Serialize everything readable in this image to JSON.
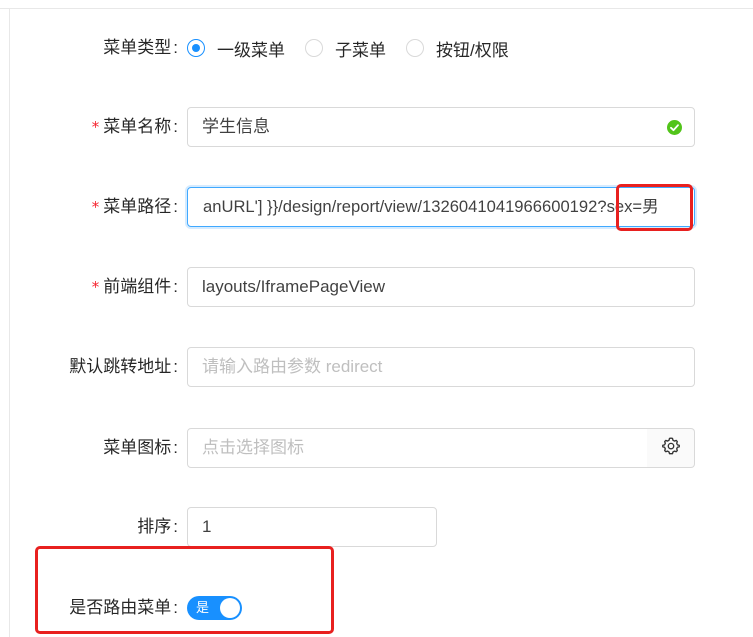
{
  "menu_type": {
    "label": "菜单类型",
    "colon": ":",
    "options": [
      {
        "label": "一级菜单",
        "checked": true
      },
      {
        "label": "子菜单",
        "checked": false
      },
      {
        "label": "按钮/权限",
        "checked": false
      }
    ]
  },
  "menu_name": {
    "required_mark": "*",
    "label": "菜单名称",
    "colon": ":",
    "value": "学生信息",
    "status_icon": "check-circle-icon"
  },
  "menu_path": {
    "required_mark": "*",
    "label": "菜单路径",
    "colon": ":",
    "value": "anURL'] }}/design/report/view/1326041041966600192?sex=男"
  },
  "frontend_component": {
    "required_mark": "*",
    "label": "前端组件",
    "colon": ":",
    "value": "layouts/IframePageView"
  },
  "default_redirect": {
    "label": "默认跳转地址",
    "colon": ":",
    "placeholder": "请输入路由参数 redirect"
  },
  "menu_icon": {
    "label": "菜单图标",
    "colon": ":",
    "placeholder": "点击选择图标",
    "addon_icon": "gear-icon"
  },
  "sort_order": {
    "label": "排序",
    "colon": ":",
    "value": "1"
  },
  "is_route": {
    "label": "是否路由菜单",
    "colon": ":",
    "switch_text": "是",
    "checked": true
  },
  "colors": {
    "primary": "#1890ff",
    "success": "#52c41a",
    "required": "#f5222d",
    "annotation_box": "#e8201f"
  }
}
